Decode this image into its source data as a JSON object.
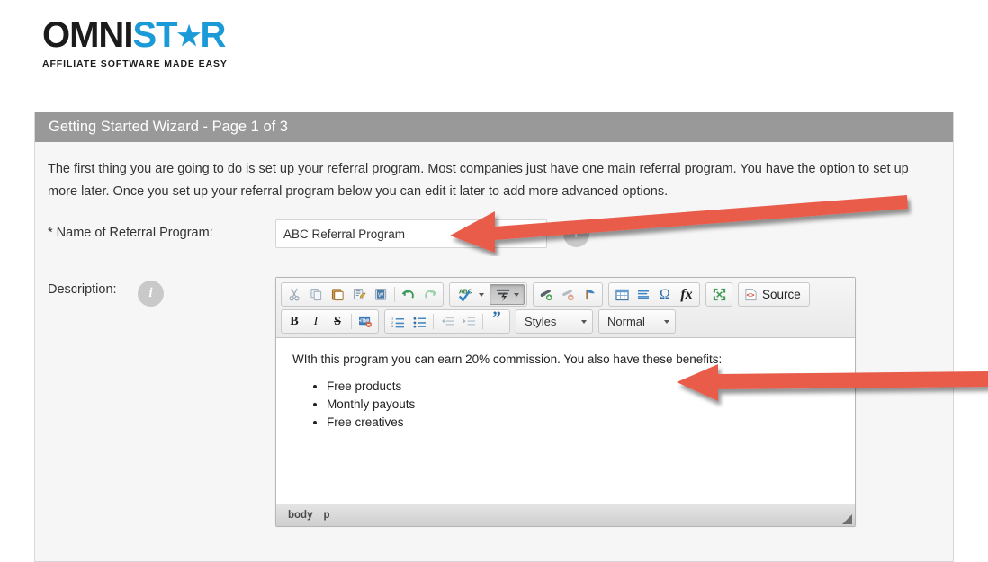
{
  "logo": {
    "part1": "OMNI",
    "part2_pre": "ST",
    "part2_star": "★",
    "part2_post": "R",
    "tagline": "AFFILIATE SOFTWARE MADE EASY"
  },
  "panel": {
    "header_title": "Getting Started Wizard - Page 1 of 3",
    "header_bg": "#999999",
    "intro_text": "The first thing you are going to do is set up your referral program. Most companies just have one main referral program. You have the option to set up more later. Once you set up your referral program below you can edit it later to add more advanced options."
  },
  "form": {
    "name_label": "* Name of Referral Program:",
    "name_value": "ABC Referral Program",
    "name_placeholder": "",
    "name_info_icon": "info-icon",
    "description_label": "Description:",
    "description_info_icon": "info-icon"
  },
  "editor": {
    "toolbar_row1": [
      {
        "name": "cut-icon",
        "label": "✂",
        "group": 1,
        "active": false
      },
      {
        "name": "copy-icon",
        "label": "⧉",
        "group": 1,
        "active": false
      },
      {
        "name": "paste-icon",
        "label": "Ὄb",
        "group": 1,
        "active": false
      },
      {
        "name": "paste-text-icon",
        "label": "T",
        "group": 1,
        "active": false
      },
      {
        "name": "paste-from-word-icon",
        "label": "W",
        "group": 1,
        "active": false
      },
      {
        "name": "undo-icon",
        "label": "↶",
        "group": 1,
        "active": false
      },
      {
        "name": "redo-icon",
        "label": "↷",
        "group": 1,
        "active": false
      },
      {
        "name": "spellcheck-icon",
        "label": "ABC",
        "group": 2,
        "active": false
      },
      {
        "name": "text-format-icon",
        "label": "⚡",
        "group": 2,
        "active": true
      },
      {
        "name": "link-icon",
        "label": "🔗",
        "group": 3,
        "active": false
      },
      {
        "name": "unlink-icon",
        "label": "🔗",
        "group": 3,
        "active": false
      },
      {
        "name": "anchor-icon",
        "label": "⚑",
        "group": 3,
        "active": false
      },
      {
        "name": "table-icon",
        "label": "▦",
        "group": 4,
        "active": false
      },
      {
        "name": "horizontal-rule-icon",
        "label": "≡",
        "group": 4,
        "active": false
      },
      {
        "name": "special-character-icon",
        "label": "Ω",
        "group": 4,
        "active": false
      },
      {
        "name": "math-formula-icon",
        "label": "fx",
        "group": 4,
        "active": false
      },
      {
        "name": "maximize-icon",
        "label": "⤡",
        "group": 5,
        "active": false
      }
    ],
    "source_button_label": "Source",
    "toolbar_row2": [
      {
        "name": "bold-icon",
        "label": "B",
        "group": 1
      },
      {
        "name": "italic-icon",
        "label": "I",
        "group": 1
      },
      {
        "name": "strikethrough-icon",
        "label": "S",
        "group": 1
      },
      {
        "name": "remove-format-icon",
        "label": "HTML",
        "group": 1
      },
      {
        "name": "numbered-list-icon",
        "label": "1.",
        "group": 2
      },
      {
        "name": "bulleted-list-icon",
        "label": "•",
        "group": 2
      },
      {
        "name": "outdent-icon",
        "label": "←≡",
        "group": 2
      },
      {
        "name": "indent-icon",
        "label": "≡→",
        "group": 2
      },
      {
        "name": "blockquote-icon",
        "label": "”",
        "group": 2
      }
    ],
    "styles_dropdown": "Styles",
    "format_dropdown": "Normal",
    "body_paragraph": "WIth this program you can earn 20% commission. You also have these benefits:",
    "body_bullets": [
      "Free products",
      "Monthly payouts",
      "Free creatives"
    ],
    "element_path": [
      "body",
      "p"
    ],
    "resize_handle": "resize-handle-icon"
  },
  "annotations": {
    "arrow_color": "#e85c4a",
    "arrow_1_name": "annotation-arrow-name-field",
    "arrow_2_name": "annotation-arrow-editor-content"
  }
}
